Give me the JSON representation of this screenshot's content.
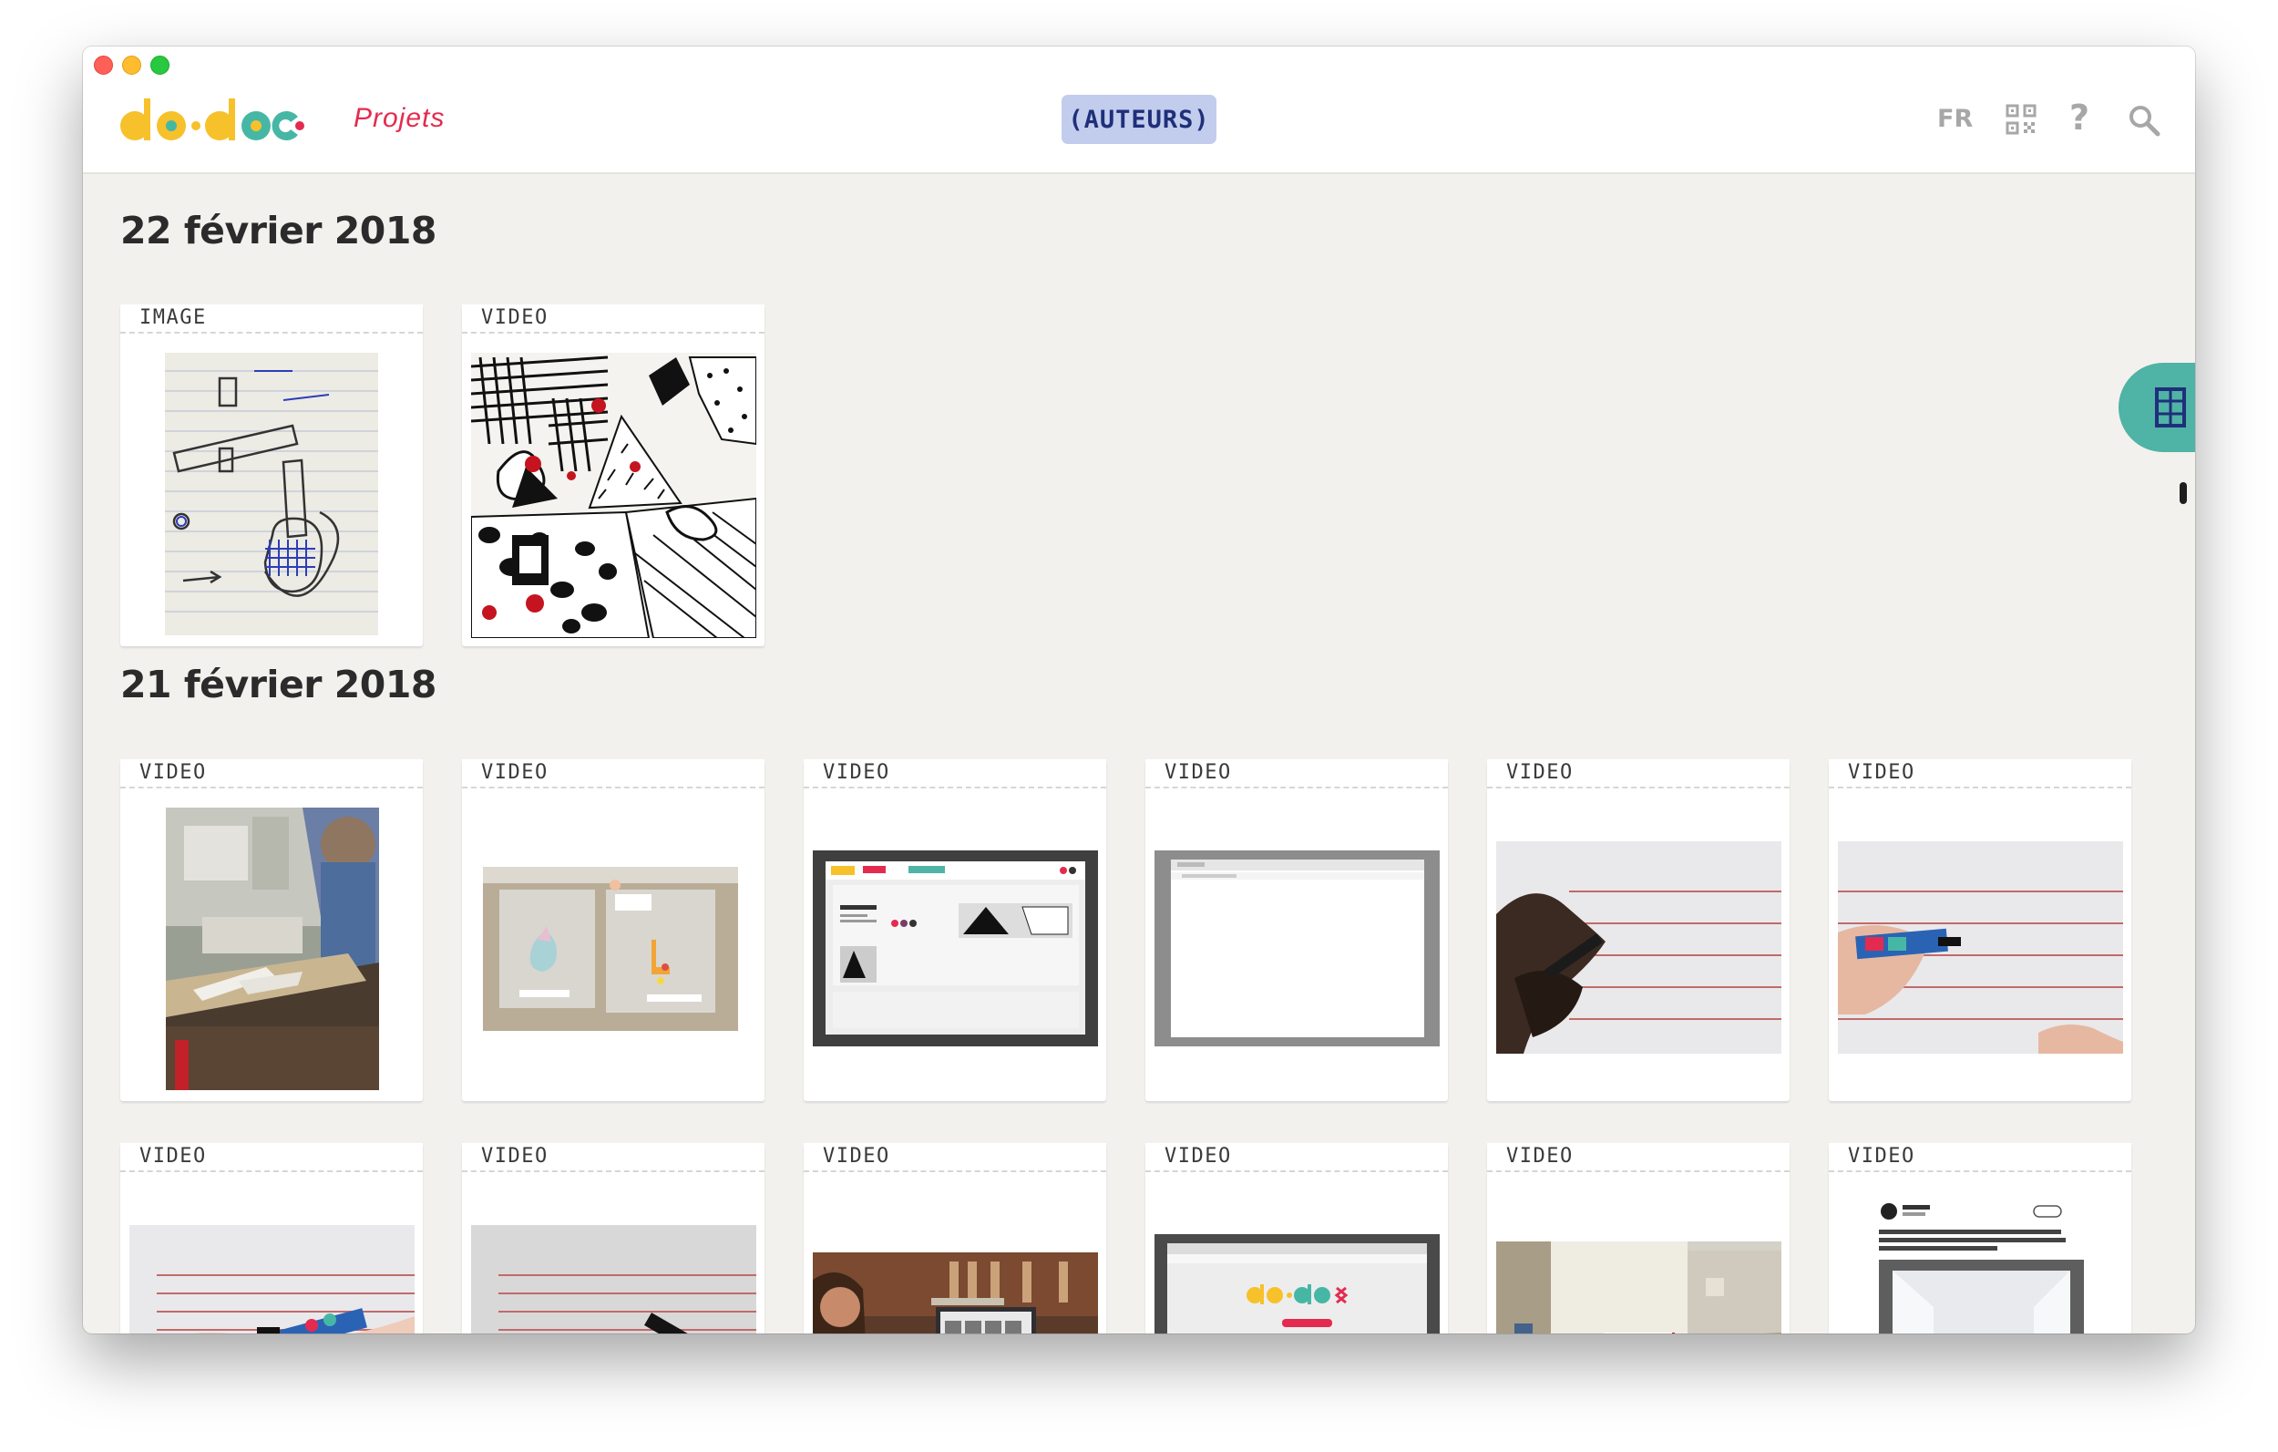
{
  "topbar": {
    "projects_link": "Projets",
    "authors_button": "(AUTEURS)",
    "lang_button": "FR",
    "help_label": "?"
  },
  "icons": {
    "logo": "do-doc-logo",
    "qr": "qr-code-icon",
    "help": "help-icon",
    "search": "search-icon",
    "side_panel": "panel-icon"
  },
  "colors": {
    "accent_red": "#e42b4f",
    "authors_bg": "#c2ccec",
    "authors_text": "#1f2f7a",
    "side_tab": "#4fb3a5",
    "logo_yellow": "#f6c12b",
    "logo_teal": "#47b7a5",
    "logo_red": "#e42b4f"
  },
  "sections": [
    {
      "title": "22 février 2018",
      "cards": [
        {
          "type": "IMAGE",
          "thumb": "sketch"
        },
        {
          "type": "VIDEO",
          "thumb": "pattern"
        }
      ]
    },
    {
      "title": "21 février 2018",
      "cards": [
        {
          "type": "VIDEO",
          "thumb": "classroom"
        },
        {
          "type": "VIDEO",
          "thumb": "shapes"
        },
        {
          "type": "VIDEO",
          "thumb": "screen-dodoc"
        },
        {
          "type": "VIDEO",
          "thumb": "screen-blank"
        },
        {
          "type": "VIDEO",
          "thumb": "hand-staff-1"
        },
        {
          "type": "VIDEO",
          "thumb": "hand-staff-2"
        },
        {
          "type": "VIDEO",
          "thumb": "hand-staff-3"
        },
        {
          "type": "VIDEO",
          "thumb": "hand-staff-4"
        },
        {
          "type": "VIDEO",
          "thumb": "laptop"
        },
        {
          "type": "VIDEO",
          "thumb": "screen-logo"
        },
        {
          "type": "VIDEO",
          "thumb": "room"
        },
        {
          "type": "VIDEO",
          "thumb": "tweet"
        }
      ]
    }
  ]
}
